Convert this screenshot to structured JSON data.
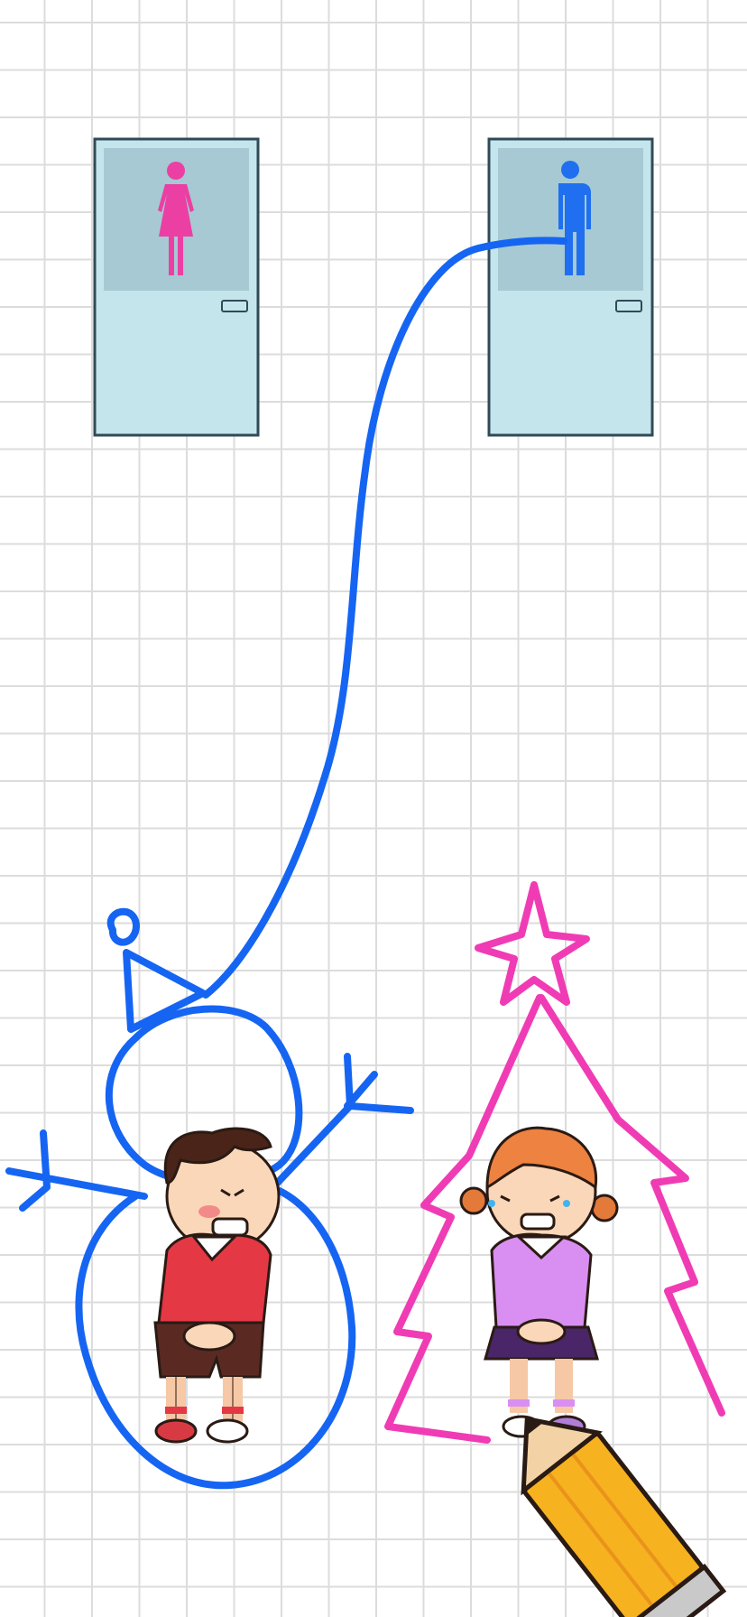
{
  "game": {
    "name": "draw-to-restroom",
    "doors": [
      {
        "id": "door-women",
        "sign": "woman-icon",
        "color": "#ec3fa3"
      },
      {
        "id": "door-men",
        "sign": "man-icon",
        "color": "#1f6ff0"
      }
    ],
    "characters": [
      {
        "id": "boy",
        "state": "needs-restroom",
        "drawn_shape": "snowman",
        "path_color": "#1565f2",
        "target": "door-men"
      },
      {
        "id": "girl",
        "state": "needs-restroom",
        "drawn_shape": "christmas-tree-with-star",
        "path_color": "#f03cb4",
        "target": "door-women"
      }
    ],
    "tool": "pencil-icon"
  },
  "colors": {
    "door_fill": "#c5e5ec",
    "door_window": "#a6c9d3",
    "door_border": "#2f4b57",
    "blue_line": "#1565f2",
    "pink_line": "#f03cb4"
  }
}
